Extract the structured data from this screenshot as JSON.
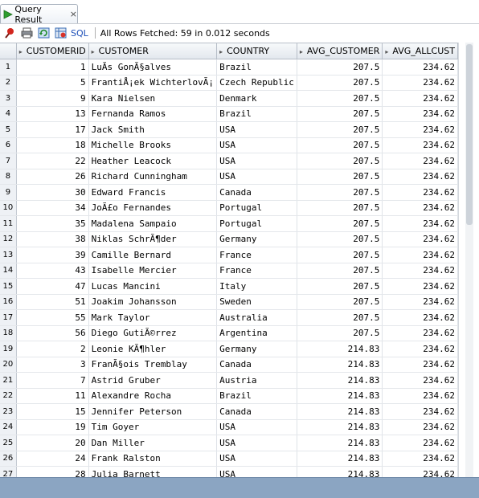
{
  "tab": {
    "title": "Query Result",
    "close": "×"
  },
  "toolbar": {
    "sql_label": "SQL",
    "status": "All Rows Fetched: 59 in 0.012 seconds"
  },
  "columns": [
    "CUSTOMERID",
    "CUSTOMER",
    "COUNTRY",
    "AVG_CUSTOMER",
    "AVG_ALLCUST"
  ],
  "rows": [
    {
      "n": "1",
      "id": "1",
      "customer": "LuÃ­s GonÃ§alves",
      "country": "Brazil",
      "avg": "207.5",
      "all": "234.62"
    },
    {
      "n": "2",
      "id": "5",
      "customer": "FrantiÅ¡ek WichterlovÃ¡",
      "country": "Czech Republic",
      "avg": "207.5",
      "all": "234.62"
    },
    {
      "n": "3",
      "id": "9",
      "customer": "Kara Nielsen",
      "country": "Denmark",
      "avg": "207.5",
      "all": "234.62"
    },
    {
      "n": "4",
      "id": "13",
      "customer": "Fernanda Ramos",
      "country": "Brazil",
      "avg": "207.5",
      "all": "234.62"
    },
    {
      "n": "5",
      "id": "17",
      "customer": "Jack Smith",
      "country": "USA",
      "avg": "207.5",
      "all": "234.62"
    },
    {
      "n": "6",
      "id": "18",
      "customer": "Michelle Brooks",
      "country": "USA",
      "avg": "207.5",
      "all": "234.62"
    },
    {
      "n": "7",
      "id": "22",
      "customer": "Heather Leacock",
      "country": "USA",
      "avg": "207.5",
      "all": "234.62"
    },
    {
      "n": "8",
      "id": "26",
      "customer": "Richard Cunningham",
      "country": "USA",
      "avg": "207.5",
      "all": "234.62"
    },
    {
      "n": "9",
      "id": "30",
      "customer": "Edward Francis",
      "country": "Canada",
      "avg": "207.5",
      "all": "234.62"
    },
    {
      "n": "10",
      "id": "34",
      "customer": "JoÃ£o Fernandes",
      "country": "Portugal",
      "avg": "207.5",
      "all": "234.62"
    },
    {
      "n": "11",
      "id": "35",
      "customer": "Madalena Sampaio",
      "country": "Portugal",
      "avg": "207.5",
      "all": "234.62"
    },
    {
      "n": "12",
      "id": "38",
      "customer": "Niklas SchrÃ¶der",
      "country": "Germany",
      "avg": "207.5",
      "all": "234.62"
    },
    {
      "n": "13",
      "id": "39",
      "customer": "Camille Bernard",
      "country": "France",
      "avg": "207.5",
      "all": "234.62"
    },
    {
      "n": "14",
      "id": "43",
      "customer": "Isabelle Mercier",
      "country": "France",
      "avg": "207.5",
      "all": "234.62"
    },
    {
      "n": "15",
      "id": "47",
      "customer": "Lucas Mancini",
      "country": "Italy",
      "avg": "207.5",
      "all": "234.62"
    },
    {
      "n": "16",
      "id": "51",
      "customer": "Joakim Johansson",
      "country": "Sweden",
      "avg": "207.5",
      "all": "234.62"
    },
    {
      "n": "17",
      "id": "55",
      "customer": "Mark Taylor",
      "country": "Australia",
      "avg": "207.5",
      "all": "234.62"
    },
    {
      "n": "18",
      "id": "56",
      "customer": "Diego GutiÃ©rrez",
      "country": "Argentina",
      "avg": "207.5",
      "all": "234.62"
    },
    {
      "n": "19",
      "id": "2",
      "customer": "Leonie KÃ¶hler",
      "country": "Germany",
      "avg": "214.83",
      "all": "234.62"
    },
    {
      "n": "20",
      "id": "3",
      "customer": "FranÃ§ois Tremblay",
      "country": "Canada",
      "avg": "214.83",
      "all": "234.62"
    },
    {
      "n": "21",
      "id": "7",
      "customer": "Astrid Gruber",
      "country": "Austria",
      "avg": "214.83",
      "all": "234.62"
    },
    {
      "n": "22",
      "id": "11",
      "customer": "Alexandre Rocha",
      "country": "Brazil",
      "avg": "214.83",
      "all": "234.62"
    },
    {
      "n": "23",
      "id": "15",
      "customer": "Jennifer Peterson",
      "country": "Canada",
      "avg": "214.83",
      "all": "234.62"
    },
    {
      "n": "24",
      "id": "19",
      "customer": "Tim Goyer",
      "country": "USA",
      "avg": "214.83",
      "all": "234.62"
    },
    {
      "n": "25",
      "id": "20",
      "customer": "Dan Miller",
      "country": "USA",
      "avg": "214.83",
      "all": "234.62"
    },
    {
      "n": "26",
      "id": "24",
      "customer": "Frank Ralston",
      "country": "USA",
      "avg": "214.83",
      "all": "234.62"
    },
    {
      "n": "27",
      "id": "28",
      "customer": "Julia Barnett",
      "country": "USA",
      "avg": "214.83",
      "all": "234.62"
    }
  ]
}
